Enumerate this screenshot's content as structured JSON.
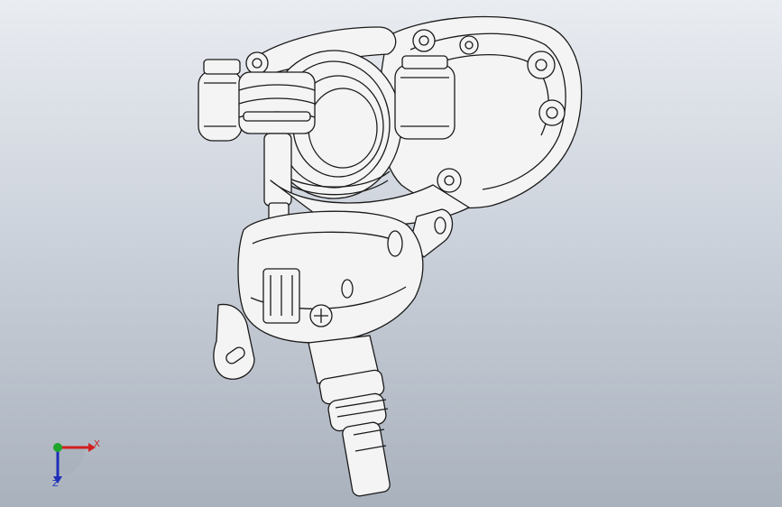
{
  "viewport": {
    "background_top": "#e9ecf1",
    "background_bottom": "#a9b1bd"
  },
  "model": {
    "icon": "cad-assembly-hidden-line-render"
  },
  "triad": {
    "x_label": "X",
    "z_label": "Z",
    "x_color": "#d21f1f",
    "y_color": "#1fa52c",
    "z_color": "#1c2fb8"
  }
}
